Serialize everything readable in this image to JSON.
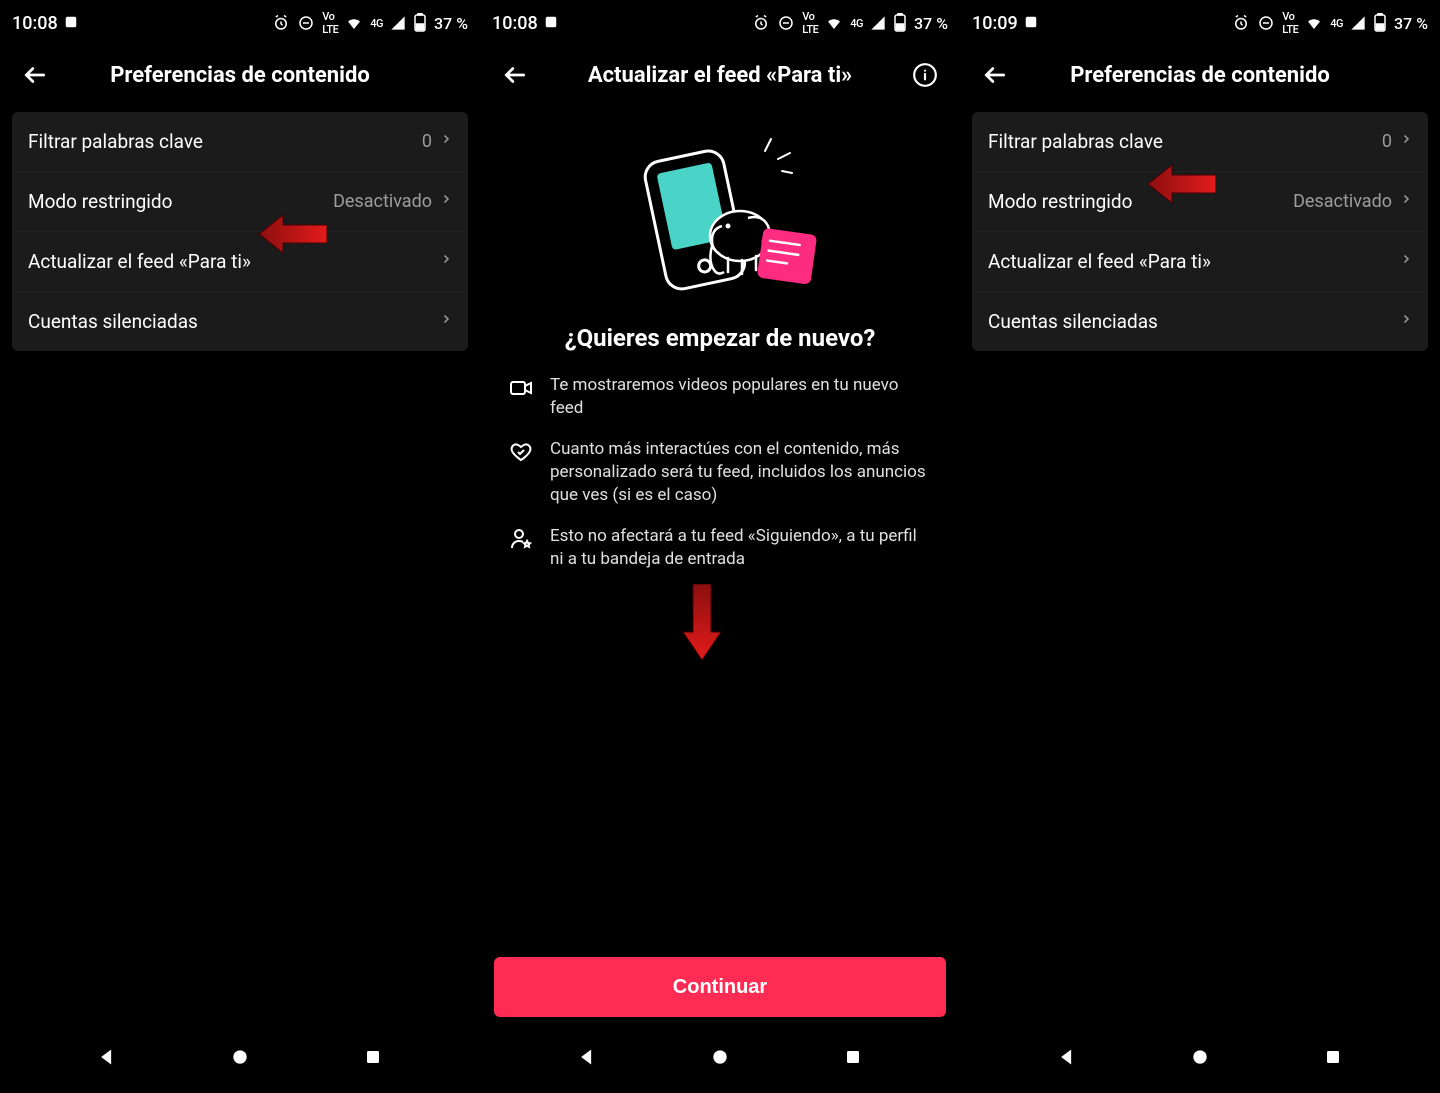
{
  "screen1": {
    "status": {
      "time": "10:08",
      "battery": "37 %",
      "net": "4G",
      "volte": "VoLTE"
    },
    "header": {
      "title": "Preferencias de contenido"
    },
    "rows": [
      {
        "label": "Filtrar palabras clave",
        "value": "0"
      },
      {
        "label": "Modo restringido",
        "value": "Desactivado"
      },
      {
        "label": "Actualizar el feed «Para ti»",
        "value": ""
      },
      {
        "label": "Cuentas silenciadas",
        "value": ""
      }
    ]
  },
  "screen2": {
    "status": {
      "time": "10:08",
      "battery": "37 %",
      "net": "4G",
      "volte": "VoLTE"
    },
    "header": {
      "title": "Actualizar el feed «Para ti»"
    },
    "heading": "¿Quieres empezar de nuevo?",
    "bullets": [
      "Te mostraremos videos populares en tu nuevo feed",
      "Cuanto más interactúes con el contenido, más personalizado será tu feed, incluidos los anuncios que ves (si es el caso)",
      "Esto no afectará a tu feed «Siguiendo», a tu perfil ni a tu bandeja de entrada"
    ],
    "button": "Continuar"
  },
  "screen3": {
    "status": {
      "time": "10:09",
      "battery": "37 %",
      "net": "4G",
      "volte": "VoLTE"
    },
    "header": {
      "title": "Preferencias de contenido"
    },
    "rows": [
      {
        "label": "Filtrar palabras clave",
        "value": "0"
      },
      {
        "label": "Modo restringido",
        "value": "Desactivado"
      },
      {
        "label": "Actualizar el feed «Para ti»",
        "value": ""
      },
      {
        "label": "Cuentas silenciadas",
        "value": ""
      }
    ]
  }
}
